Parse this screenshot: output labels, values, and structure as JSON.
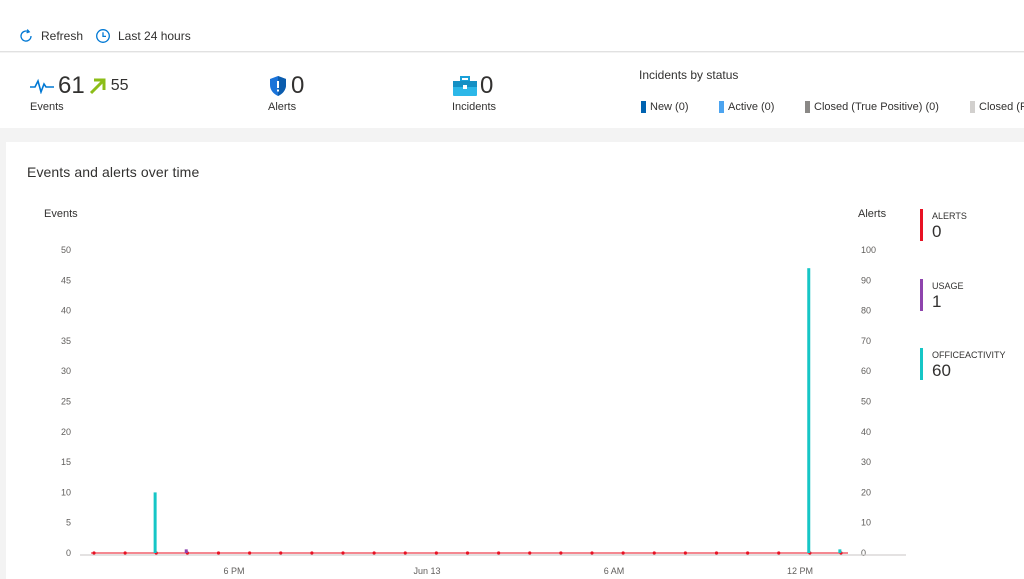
{
  "toolbar": {
    "refresh_label": "Refresh",
    "time_label": "Last 24 hours"
  },
  "summary": {
    "events": {
      "value": "61",
      "trend_value": "55",
      "label": "Events"
    },
    "alerts": {
      "value": "0",
      "label": "Alerts"
    },
    "incidents": {
      "value": "0",
      "label": "Incidents"
    },
    "status": {
      "title": "Incidents by status",
      "items": [
        {
          "label": "New (0)",
          "color": "#0063b1"
        },
        {
          "label": "Active (0)",
          "color": "#4ca4f0"
        },
        {
          "label": "Closed (True Positive) (0)",
          "color": "#8a8886"
        },
        {
          "label": "Closed (F",
          "color": "#d2d0ce"
        }
      ]
    }
  },
  "chart": {
    "title": "Events and alerts over time",
    "left_axis_label": "Events",
    "right_axis_label": "Alerts"
  },
  "legend": [
    {
      "name": "ALERTS",
      "value": "0",
      "color": "#e81123"
    },
    {
      "name": "USAGE",
      "value": "1",
      "color": "#8e44ad"
    },
    {
      "name": "OFFICEACTIVITY",
      "value": "60",
      "color": "#16c6c6"
    }
  ],
  "chart_data": {
    "type": "bar",
    "title": "Events and alerts over time",
    "ylabel": "Events",
    "y2label": "Alerts",
    "ylim": [
      0,
      50
    ],
    "y2lim": [
      0,
      100
    ],
    "yticks": [
      0,
      5,
      10,
      15,
      20,
      25,
      30,
      35,
      40,
      45,
      50
    ],
    "y2ticks": [
      0,
      10,
      20,
      30,
      40,
      50,
      60,
      70,
      80,
      90,
      100
    ],
    "xticks": [
      "6 PM",
      "Jun 13",
      "6 AM",
      "12 PM"
    ],
    "series": [
      {
        "name": "OFFICEACTIVITY",
        "color": "#16c6c6",
        "points": [
          {
            "slot": 1,
            "value": 10
          },
          {
            "slot": 22,
            "value": 47
          },
          {
            "slot": 23,
            "value": 0.6
          }
        ]
      },
      {
        "name": "USAGE",
        "color": "#8e44ad",
        "points": [
          {
            "slot": 2,
            "value": 0.6
          }
        ]
      },
      {
        "name": "ALERTS",
        "color": "#e81123",
        "points": []
      }
    ],
    "slot_count": 25
  },
  "icons": {
    "refresh": "refresh-icon",
    "clock": "clock-icon",
    "pulse": "pulse-icon",
    "trend": "trend-up-icon",
    "shield": "shield-icon",
    "briefcase": "briefcase-icon"
  }
}
